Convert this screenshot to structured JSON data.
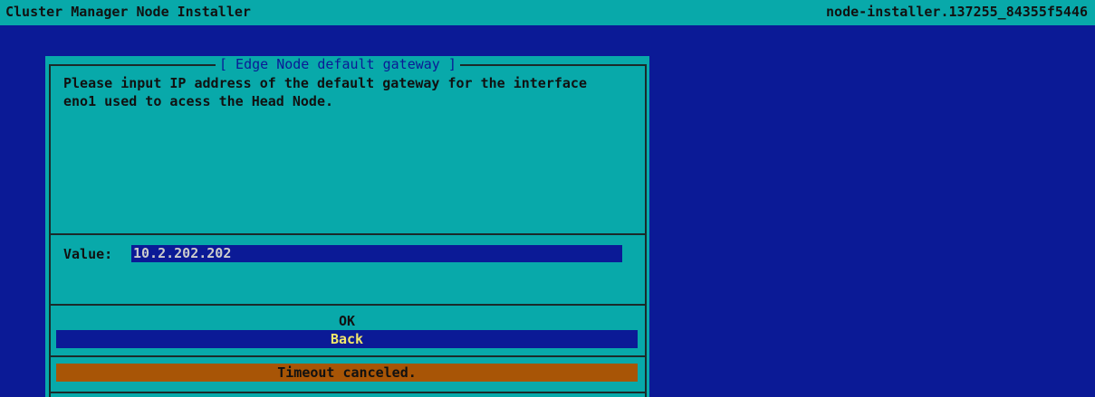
{
  "header": {
    "app_title": "Cluster Manager Node Installer",
    "host_id": "node-installer.137255_84355f5446"
  },
  "dialog": {
    "title": "[ Edge Node default gateway ]",
    "message_lines": [
      "Please input IP address of the default gateway for the interface",
      "eno1 used to acess the Head Node."
    ],
    "value_label": "Value:",
    "value": "10.2.202.202",
    "buttons": {
      "ok": "OK",
      "back": "Back"
    },
    "status": "Timeout canceled."
  },
  "colors": {
    "screen_background": "#0b1a96",
    "dialog_background": "#08a9aa",
    "selected_highlight": "#0b1a96",
    "selected_text": "#f2e66a",
    "status_bar": "#a85506"
  }
}
